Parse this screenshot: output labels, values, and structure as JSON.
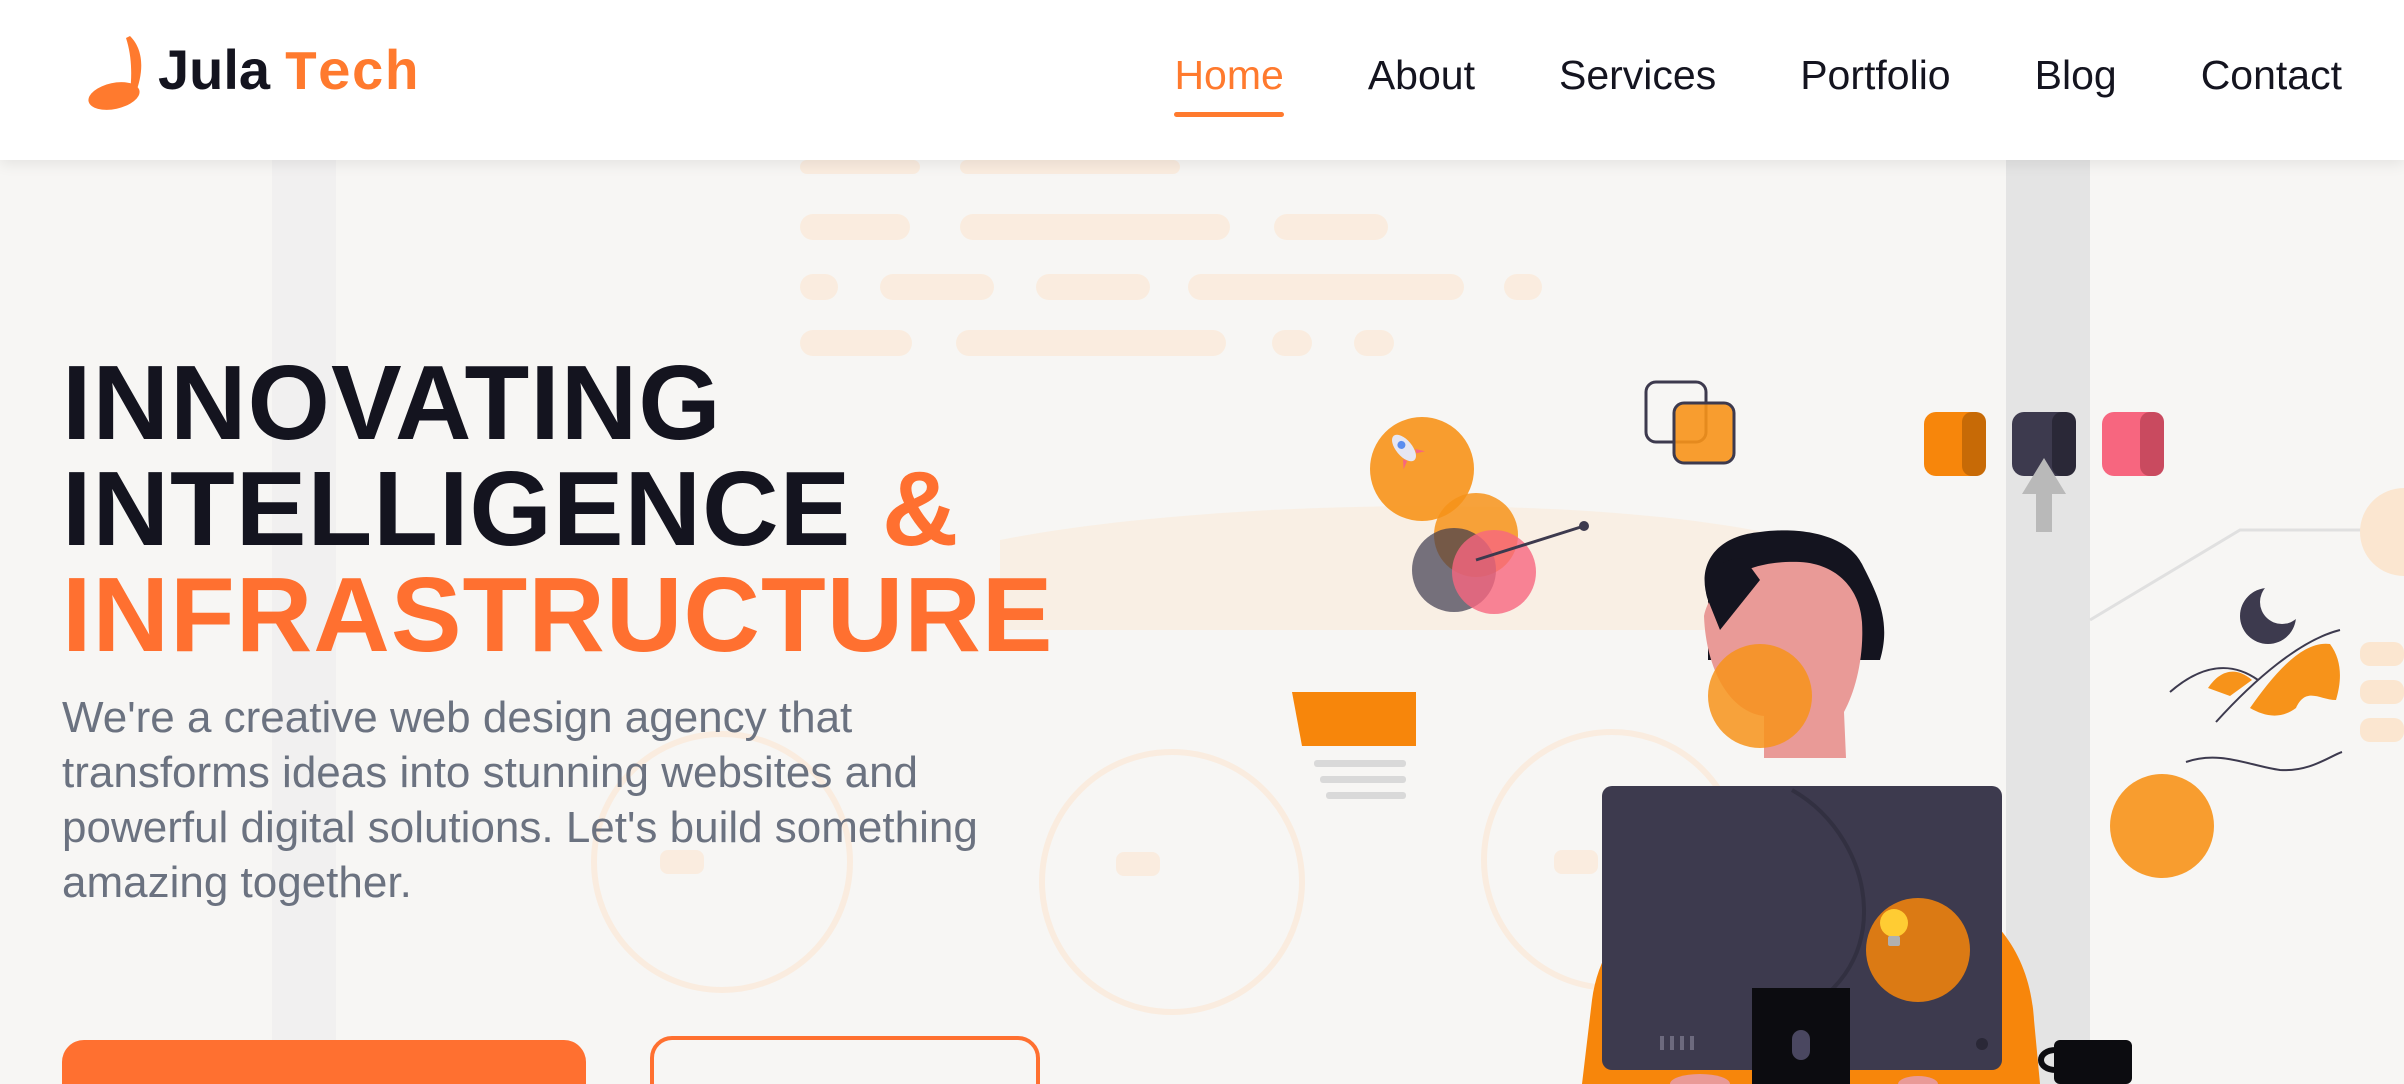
{
  "brand": {
    "name_part1": "Jula",
    "name_part2": "Tech",
    "accent_color": "#ff7a2e",
    "dark_color": "#14141f"
  },
  "nav": {
    "items": [
      {
        "label": "Home",
        "active": true
      },
      {
        "label": "About",
        "active": false
      },
      {
        "label": "Services",
        "active": false
      },
      {
        "label": "Portfolio",
        "active": false
      },
      {
        "label": "Blog",
        "active": false
      },
      {
        "label": "Contact",
        "active": false
      }
    ]
  },
  "hero": {
    "title_line1": "INNOVATING",
    "title_line2": "INTELLIGENCE",
    "title_amp": "&",
    "title_line3": "INFRASTRUCTURE",
    "description": "We're a creative web design agency that transforms ideas into stunning websites and powerful digital solutions. Let's build something amazing together.",
    "illustration_icons": [
      "rocket-icon",
      "lightbulb-icon",
      "cursor-arrow-icon"
    ]
  },
  "colors": {
    "orange": "#ff7030",
    "orange_illustration": "#f7931a",
    "dark_navy": "#3d3a4e",
    "pink": "#f7667f",
    "text_gray": "#6b7280",
    "hero_bg": "#f7f6f4"
  }
}
